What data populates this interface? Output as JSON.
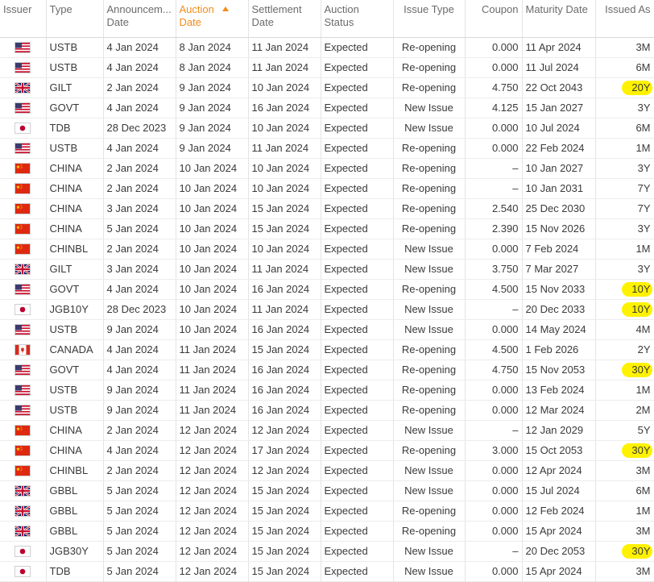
{
  "columns": {
    "issuer": "Issuer",
    "type": "Type",
    "announcement_date": "Announcem... Date",
    "auction_date": "Auction Date",
    "settlement_date": "Settlement Date",
    "auction_status": "Auction Status",
    "issue_type": "Issue Type",
    "coupon": "Coupon",
    "maturity_date": "Maturity Date",
    "issued_as": "Issued As"
  },
  "colors": {
    "sort_accent": "#f08c1a",
    "highlight": "#fff200"
  },
  "rows": [
    {
      "flag": "us-flag-icon",
      "type": "USTB",
      "announce": "4 Jan 2024",
      "auction": "8 Jan 2024",
      "settle": "11 Jan 2024",
      "status": "Expected",
      "issue_type": "Re-opening",
      "coupon": "0.000",
      "maturity": "11 Apr 2024",
      "issued_as": "3M",
      "highlight": false
    },
    {
      "flag": "us-flag-icon",
      "type": "USTB",
      "announce": "4 Jan 2024",
      "auction": "8 Jan 2024",
      "settle": "11 Jan 2024",
      "status": "Expected",
      "issue_type": "Re-opening",
      "coupon": "0.000",
      "maturity": "11 Jul 2024",
      "issued_as": "6M",
      "highlight": false
    },
    {
      "flag": "uk-flag-icon",
      "type": "GILT",
      "announce": "2 Jan 2024",
      "auction": "9 Jan 2024",
      "settle": "10 Jan 2024",
      "status": "Expected",
      "issue_type": "Re-opening",
      "coupon": "4.750",
      "maturity": "22 Oct 2043",
      "issued_as": "20Y",
      "highlight": true
    },
    {
      "flag": "us-flag-icon",
      "type": "GOVT",
      "announce": "4 Jan 2024",
      "auction": "9 Jan 2024",
      "settle": "16 Jan 2024",
      "status": "Expected",
      "issue_type": "New Issue",
      "coupon": "4.125",
      "maturity": "15 Jan 2027",
      "issued_as": "3Y",
      "highlight": false
    },
    {
      "flag": "jp-flag-icon",
      "type": "TDB",
      "announce": "28 Dec 2023",
      "auction": "9 Jan 2024",
      "settle": "10 Jan 2024",
      "status": "Expected",
      "issue_type": "New Issue",
      "coupon": "0.000",
      "maturity": "10 Jul 2024",
      "issued_as": "6M",
      "highlight": false
    },
    {
      "flag": "us-flag-icon",
      "type": "USTB",
      "announce": "4 Jan 2024",
      "auction": "9 Jan 2024",
      "settle": "11 Jan 2024",
      "status": "Expected",
      "issue_type": "Re-opening",
      "coupon": "0.000",
      "maturity": "22 Feb 2024",
      "issued_as": "1M",
      "highlight": false
    },
    {
      "flag": "cn-flag-icon",
      "type": "CHINA",
      "announce": "2 Jan 2024",
      "auction": "10 Jan 2024",
      "settle": "10 Jan 2024",
      "status": "Expected",
      "issue_type": "Re-opening",
      "coupon": "–",
      "maturity": "10 Jan 2027",
      "issued_as": "3Y",
      "highlight": false
    },
    {
      "flag": "cn-flag-icon",
      "type": "CHINA",
      "announce": "2 Jan 2024",
      "auction": "10 Jan 2024",
      "settle": "10 Jan 2024",
      "status": "Expected",
      "issue_type": "Re-opening",
      "coupon": "–",
      "maturity": "10 Jan 2031",
      "issued_as": "7Y",
      "highlight": false
    },
    {
      "flag": "cn-flag-icon",
      "type": "CHINA",
      "announce": "3 Jan 2024",
      "auction": "10 Jan 2024",
      "settle": "15 Jan 2024",
      "status": "Expected",
      "issue_type": "Re-opening",
      "coupon": "2.540",
      "maturity": "25 Dec 2030",
      "issued_as": "7Y",
      "highlight": false
    },
    {
      "flag": "cn-flag-icon",
      "type": "CHINA",
      "announce": "5 Jan 2024",
      "auction": "10 Jan 2024",
      "settle": "15 Jan 2024",
      "status": "Expected",
      "issue_type": "Re-opening",
      "coupon": "2.390",
      "maturity": "15 Nov 2026",
      "issued_as": "3Y",
      "highlight": false
    },
    {
      "flag": "cn-flag-icon",
      "type": "CHINBL",
      "announce": "2 Jan 2024",
      "auction": "10 Jan 2024",
      "settle": "10 Jan 2024",
      "status": "Expected",
      "issue_type": "New Issue",
      "coupon": "0.000",
      "maturity": "7 Feb 2024",
      "issued_as": "1M",
      "highlight": false
    },
    {
      "flag": "uk-flag-icon",
      "type": "GILT",
      "announce": "3 Jan 2024",
      "auction": "10 Jan 2024",
      "settle": "11 Jan 2024",
      "status": "Expected",
      "issue_type": "New Issue",
      "coupon": "3.750",
      "maturity": "7 Mar 2027",
      "issued_as": "3Y",
      "highlight": false
    },
    {
      "flag": "us-flag-icon",
      "type": "GOVT",
      "announce": "4 Jan 2024",
      "auction": "10 Jan 2024",
      "settle": "16 Jan 2024",
      "status": "Expected",
      "issue_type": "Re-opening",
      "coupon": "4.500",
      "maturity": "15 Nov 2033",
      "issued_as": "10Y",
      "highlight": true
    },
    {
      "flag": "jp-flag-icon",
      "type": "JGB10Y",
      "announce": "28 Dec 2023",
      "auction": "10 Jan 2024",
      "settle": "11 Jan 2024",
      "status": "Expected",
      "issue_type": "New Issue",
      "coupon": "–",
      "maturity": "20 Dec 2033",
      "issued_as": "10Y",
      "highlight": true
    },
    {
      "flag": "us-flag-icon",
      "type": "USTB",
      "announce": "9 Jan 2024",
      "auction": "10 Jan 2024",
      "settle": "16 Jan 2024",
      "status": "Expected",
      "issue_type": "New Issue",
      "coupon": "0.000",
      "maturity": "14 May 2024",
      "issued_as": "4M",
      "highlight": false
    },
    {
      "flag": "ca-flag-icon",
      "type": "CANADA",
      "announce": "4 Jan 2024",
      "auction": "11 Jan 2024",
      "settle": "15 Jan 2024",
      "status": "Expected",
      "issue_type": "Re-opening",
      "coupon": "4.500",
      "maturity": "1 Feb 2026",
      "issued_as": "2Y",
      "highlight": false
    },
    {
      "flag": "us-flag-icon",
      "type": "GOVT",
      "announce": "4 Jan 2024",
      "auction": "11 Jan 2024",
      "settle": "16 Jan 2024",
      "status": "Expected",
      "issue_type": "Re-opening",
      "coupon": "4.750",
      "maturity": "15 Nov 2053",
      "issued_as": "30Y",
      "highlight": true
    },
    {
      "flag": "us-flag-icon",
      "type": "USTB",
      "announce": "9 Jan 2024",
      "auction": "11 Jan 2024",
      "settle": "16 Jan 2024",
      "status": "Expected",
      "issue_type": "Re-opening",
      "coupon": "0.000",
      "maturity": "13 Feb 2024",
      "issued_as": "1M",
      "highlight": false
    },
    {
      "flag": "us-flag-icon",
      "type": "USTB",
      "announce": "9 Jan 2024",
      "auction": "11 Jan 2024",
      "settle": "16 Jan 2024",
      "status": "Expected",
      "issue_type": "Re-opening",
      "coupon": "0.000",
      "maturity": "12 Mar 2024",
      "issued_as": "2M",
      "highlight": false
    },
    {
      "flag": "cn-flag-icon",
      "type": "CHINA",
      "announce": "2 Jan 2024",
      "auction": "12 Jan 2024",
      "settle": "12 Jan 2024",
      "status": "Expected",
      "issue_type": "New Issue",
      "coupon": "–",
      "maturity": "12 Jan 2029",
      "issued_as": "5Y",
      "highlight": false
    },
    {
      "flag": "cn-flag-icon",
      "type": "CHINA",
      "announce": "4 Jan 2024",
      "auction": "12 Jan 2024",
      "settle": "17 Jan 2024",
      "status": "Expected",
      "issue_type": "Re-opening",
      "coupon": "3.000",
      "maturity": "15 Oct 2053",
      "issued_as": "30Y",
      "highlight": true
    },
    {
      "flag": "cn-flag-icon",
      "type": "CHINBL",
      "announce": "2 Jan 2024",
      "auction": "12 Jan 2024",
      "settle": "12 Jan 2024",
      "status": "Expected",
      "issue_type": "New Issue",
      "coupon": "0.000",
      "maturity": "12 Apr 2024",
      "issued_as": "3M",
      "highlight": false
    },
    {
      "flag": "uk-flag-icon",
      "type": "GBBL",
      "announce": "5 Jan 2024",
      "auction": "12 Jan 2024",
      "settle": "15 Jan 2024",
      "status": "Expected",
      "issue_type": "New Issue",
      "coupon": "0.000",
      "maturity": "15 Jul 2024",
      "issued_as": "6M",
      "highlight": false
    },
    {
      "flag": "uk-flag-icon",
      "type": "GBBL",
      "announce": "5 Jan 2024",
      "auction": "12 Jan 2024",
      "settle": "15 Jan 2024",
      "status": "Expected",
      "issue_type": "Re-opening",
      "coupon": "0.000",
      "maturity": "12 Feb 2024",
      "issued_as": "1M",
      "highlight": false
    },
    {
      "flag": "uk-flag-icon",
      "type": "GBBL",
      "announce": "5 Jan 2024",
      "auction": "12 Jan 2024",
      "settle": "15 Jan 2024",
      "status": "Expected",
      "issue_type": "Re-opening",
      "coupon": "0.000",
      "maturity": "15 Apr 2024",
      "issued_as": "3M",
      "highlight": false
    },
    {
      "flag": "jp-flag-icon",
      "type": "JGB30Y",
      "announce": "5 Jan 2024",
      "auction": "12 Jan 2024",
      "settle": "15 Jan 2024",
      "status": "Expected",
      "issue_type": "New Issue",
      "coupon": "–",
      "maturity": "20 Dec 2053",
      "issued_as": "30Y",
      "highlight": true
    },
    {
      "flag": "jp-flag-icon",
      "type": "TDB",
      "announce": "5 Jan 2024",
      "auction": "12 Jan 2024",
      "settle": "15 Jan 2024",
      "status": "Expected",
      "issue_type": "New Issue",
      "coupon": "0.000",
      "maturity": "15 Apr 2024",
      "issued_as": "3M",
      "highlight": false
    }
  ]
}
